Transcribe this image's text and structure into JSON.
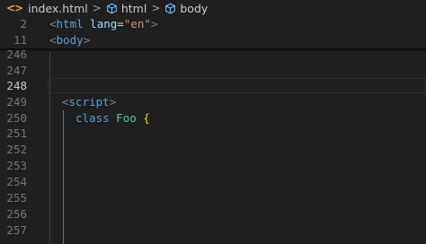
{
  "breadcrumb": {
    "file_icon": "<>",
    "file": "index.html",
    "sep": ">",
    "items": [
      "html",
      "body"
    ]
  },
  "sticky": [
    {
      "num": "2",
      "tag": "html",
      "attr": "lang",
      "value": "\"en\""
    },
    {
      "num": "11",
      "tag": "body"
    }
  ],
  "lines": [
    {
      "num": "246"
    },
    {
      "num": "247"
    },
    {
      "num": "248"
    },
    {
      "num": "249",
      "tag": "script"
    },
    {
      "num": "250",
      "keyword": "class",
      "name": "Foo",
      "brace": "{"
    },
    {
      "num": "251"
    },
    {
      "num": "252"
    },
    {
      "num": "253"
    },
    {
      "num": "254"
    },
    {
      "num": "255"
    },
    {
      "num": "256"
    },
    {
      "num": "257"
    }
  ],
  "colors": {
    "background": "#1f1f1f",
    "tag": "#569cd6",
    "attribute": "#9cdcfe",
    "string": "#ce9178",
    "class_name": "#4ec9b0",
    "bracket_highlight": "#ffd700"
  }
}
